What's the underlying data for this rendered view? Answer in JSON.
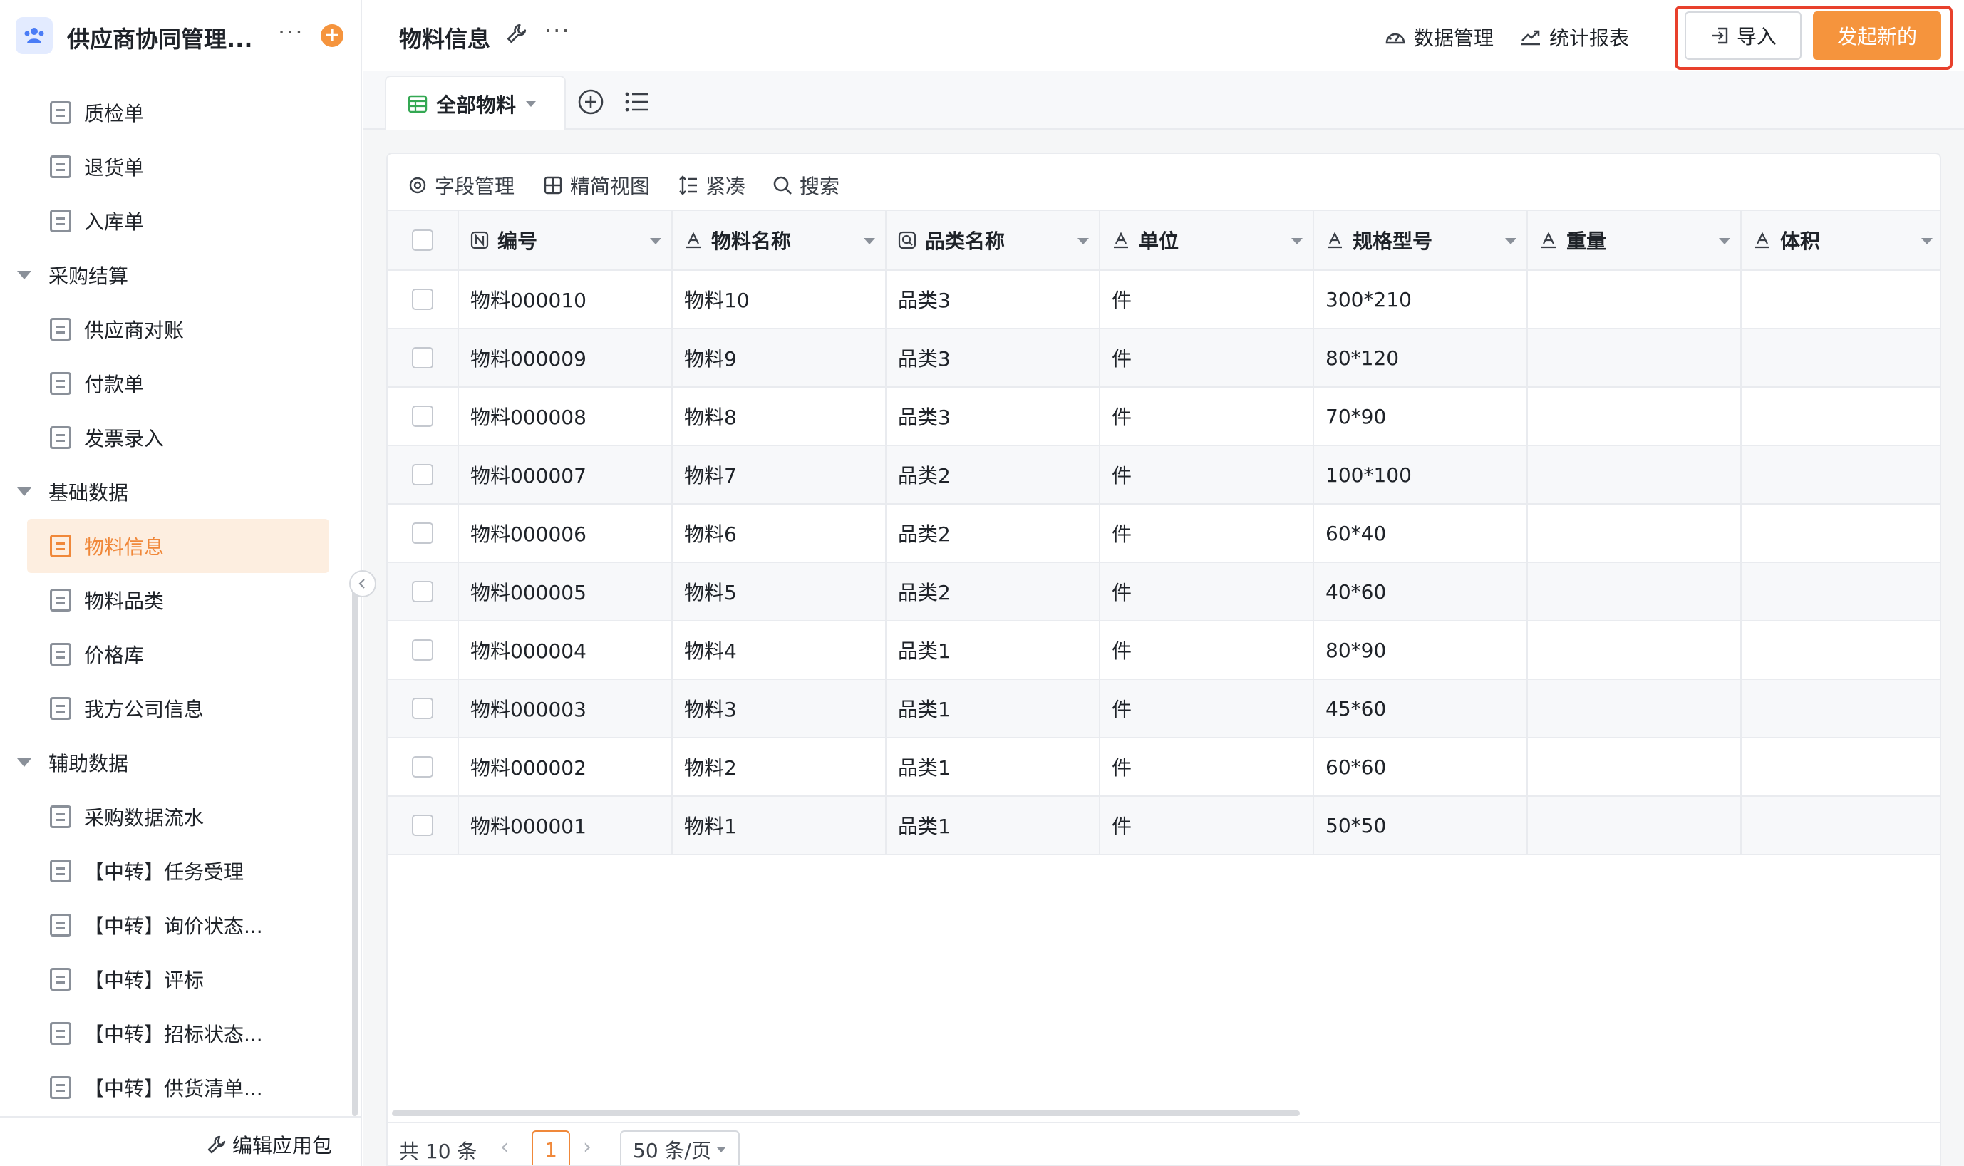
{
  "app": {
    "title": "供应商协同管理...",
    "more": "···",
    "add": "+"
  },
  "sidebar": {
    "items": [
      {
        "type": "page",
        "label": "质检单"
      },
      {
        "type": "page",
        "label": "退货单"
      },
      {
        "type": "page",
        "label": "入库单"
      },
      {
        "type": "group",
        "label": "采购结算"
      },
      {
        "type": "page",
        "label": "供应商对账"
      },
      {
        "type": "page",
        "label": "付款单"
      },
      {
        "type": "page",
        "label": "发票录入"
      },
      {
        "type": "group",
        "label": "基础数据"
      },
      {
        "type": "page",
        "label": "物料信息",
        "active": true
      },
      {
        "type": "page",
        "label": "物料品类"
      },
      {
        "type": "page",
        "label": "价格库"
      },
      {
        "type": "page",
        "label": "我方公司信息"
      },
      {
        "type": "group",
        "label": "辅助数据"
      },
      {
        "type": "page",
        "label": "采购数据流水"
      },
      {
        "type": "page",
        "label": "【中转】任务受理"
      },
      {
        "type": "page",
        "label": "【中转】询价状态..."
      },
      {
        "type": "page",
        "label": "【中转】评标"
      },
      {
        "type": "page",
        "label": "【中转】招标状态..."
      },
      {
        "type": "page",
        "label": "【中转】供货清单..."
      }
    ],
    "footer_label": "编辑应用包"
  },
  "header": {
    "title": "物料信息",
    "more": "···",
    "data_manage": "数据管理",
    "stats_report": "统计报表",
    "import_label": "导入",
    "new_label": "发起新的"
  },
  "view": {
    "tab_label": "全部物料"
  },
  "toolbar": {
    "field_manage": "字段管理",
    "simple_view": "精简视图",
    "compact": "紧凑",
    "search": "搜索"
  },
  "table": {
    "columns": [
      "编号",
      "物料名称",
      "品类名称",
      "单位",
      "规格型号",
      "重量",
      "体积"
    ],
    "rows": [
      [
        "物料000010",
        "物料10",
        "品类3",
        "件",
        "300*210",
        "",
        ""
      ],
      [
        "物料000009",
        "物料9",
        "品类3",
        "件",
        "80*120",
        "",
        ""
      ],
      [
        "物料000008",
        "物料8",
        "品类3",
        "件",
        "70*90",
        "",
        ""
      ],
      [
        "物料000007",
        "物料7",
        "品类2",
        "件",
        "100*100",
        "",
        ""
      ],
      [
        "物料000006",
        "物料6",
        "品类2",
        "件",
        "60*40",
        "",
        ""
      ],
      [
        "物料000005",
        "物料5",
        "品类2",
        "件",
        "40*60",
        "",
        ""
      ],
      [
        "物料000004",
        "物料4",
        "品类1",
        "件",
        "80*90",
        "",
        ""
      ],
      [
        "物料000003",
        "物料3",
        "品类1",
        "件",
        "45*60",
        "",
        ""
      ],
      [
        "物料000002",
        "物料2",
        "品类1",
        "件",
        "60*60",
        "",
        ""
      ],
      [
        "物料000001",
        "物料1",
        "品类1",
        "件",
        "50*50",
        "",
        ""
      ]
    ]
  },
  "pager": {
    "total": "共 10 条",
    "prev": "‹",
    "current": "1",
    "next": "›",
    "page_size": "50 条/页"
  },
  "colors": {
    "accent": "#f5943d",
    "active_text": "#f0883a",
    "active_bg": "#fdeee0",
    "highlight": "#e8402c"
  }
}
